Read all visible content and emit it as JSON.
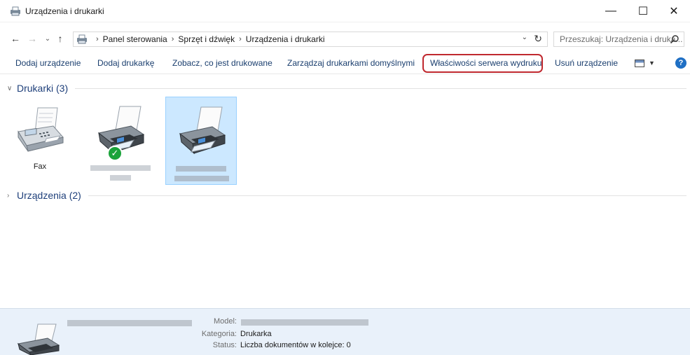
{
  "window": {
    "title": "Urządzenia i drukarki",
    "controls": {
      "minimize": "—",
      "maximize": "☐",
      "close": "✕"
    }
  },
  "nav": {
    "back": "←",
    "forward": "→",
    "recent": "⌄",
    "up": "↑",
    "breadcrumbs": [
      "Panel sterowania",
      "Sprzęt i dźwięk",
      "Urządzenia i drukarki"
    ],
    "separator": "›",
    "dropdown": "⌄",
    "refresh": "↻",
    "search_placeholder": "Przeszukaj: Urządzenia i druka..."
  },
  "commands": {
    "add_device": "Dodaj urządzenie",
    "add_printer": "Dodaj drukarkę",
    "see_printing": "Zobacz, co jest drukowane",
    "manage_default": "Zarządzaj drukarkami domyślnymi",
    "server_properties": "Właściwości serwera wydruku",
    "remove_device": "Usuń urządzenie",
    "view_caret": "▼",
    "help": "?"
  },
  "groups": {
    "printers": {
      "caret": "∨",
      "title": "Drukarki (3)"
    },
    "devices": {
      "caret": "›",
      "title": "Urządzenia (2)"
    }
  },
  "devices": [
    {
      "label": "Fax",
      "icon": "fax-icon",
      "default": false,
      "selected": false
    },
    {
      "label": "",
      "icon": "printer-icon",
      "default": true,
      "selected": false
    },
    {
      "label": "",
      "icon": "printer-icon",
      "default": false,
      "selected": true
    }
  ],
  "details": {
    "model_label": "Model:",
    "category_label": "Kategoria:",
    "category_value": "Drukarka",
    "status_label": "Status:",
    "status_value": "Liczba dokumentów w kolejce: 0"
  },
  "colors": {
    "accent": "#1e3f7a",
    "highlight_outline": "#c0292f",
    "selection_bg": "#cce8ff",
    "details_bg": "#e9f1fa",
    "default_badge": "#1aa33a"
  }
}
